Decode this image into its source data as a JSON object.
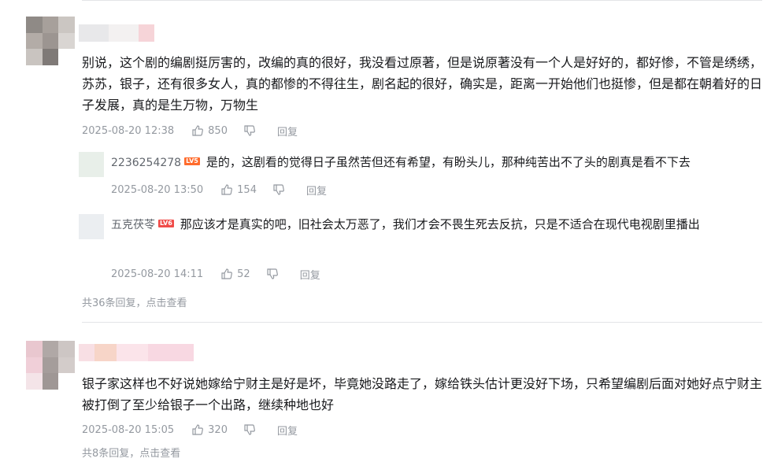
{
  "comments": [
    {
      "text": "别说，这个剧的编剧挺厉害的，改编的真的很好，我没看过原著，但是说原著没有一个人是好好的，都好惨，不管是绣绣，苏苏，银子，还有很多女人，真的都惨的不得往生，剧名起的很好，确实是，距离一开始他们也挺惨，但是都在朝着好的日子发展，真的是生万物，万物生",
      "time": "2025-08-20 12:38",
      "likes": "850",
      "reply_label": "回复",
      "replies": [
        {
          "name": "2236254278",
          "level": "LV5",
          "text": "是的，这剧看的觉得日子虽然苦但还有希望，有盼头儿，那种纯苦出不了头的剧真是看不下去",
          "time": "2025-08-20 13:50",
          "likes": "154",
          "reply_label": "回复"
        },
        {
          "name": "五克茯苓",
          "level": "LV6",
          "text": "那应该才是真实的吧，旧社会太万恶了，我们才会不畏生死去反抗，只是不适合在现代电视剧里播出",
          "time": "2025-08-20 14:11",
          "likes": "52",
          "reply_label": "回复"
        }
      ],
      "more_replies": "共36条回复，点击查看"
    },
    {
      "text": "银子家这样也不好说她嫁给宁财主是好是坏，毕竟她没路走了，嫁给铁头估计更没好下场，只希望编剧后面对她好点宁财主被打倒了至少给银子一个出路，继续种地也好",
      "time": "2025-08-20 15:05",
      "likes": "320",
      "reply_label": "回复",
      "more_replies": "共8条回复，点击查看"
    }
  ],
  "icons": {
    "like": "thumbs-up-icon",
    "dislike": "thumbs-down-icon"
  },
  "colors": {
    "meta": "#9499a0",
    "lv5": "#ff6b2c",
    "lv6": "#f04c49",
    "divider": "#e3e5e7"
  }
}
